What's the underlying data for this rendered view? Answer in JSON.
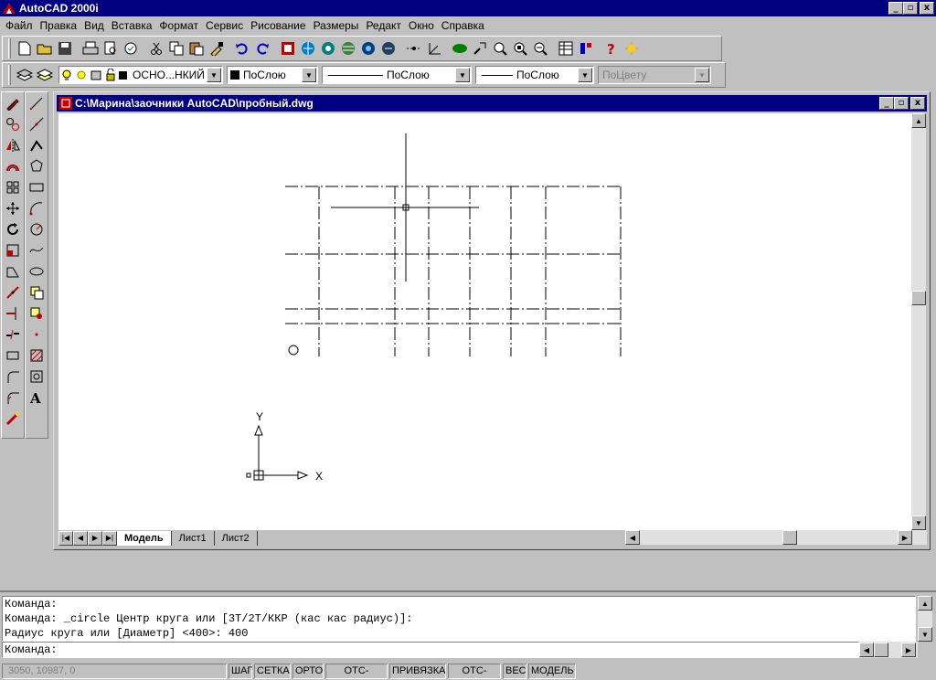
{
  "app": {
    "title": "AutoCAD 2000i",
    "window_buttons": [
      "_",
      "▫",
      "x"
    ]
  },
  "menu": [
    "Файл",
    "Правка",
    "Вид",
    "Вставка",
    "Формат",
    "Сервис",
    "Рисование",
    "Размеры",
    "Редакт",
    "Окно",
    "Справка"
  ],
  "toolbar_standard": {
    "icons": [
      "new-icon",
      "open-icon",
      "save-icon",
      "print-icon",
      "print-preview-icon",
      "spellcheck-icon",
      "cut-icon",
      "copy-icon",
      "paste-icon",
      "match-properties-icon",
      "undo-icon",
      "redo-icon",
      "cad-center-icon",
      "globe-icon",
      "hyperlink-icon",
      "web-icon",
      "browser-icon",
      "browse-icon",
      "snap-icon",
      "ucs-icon",
      "pan-realtime-icon",
      "zoom-realtime-icon",
      "zoom-window-icon",
      "zoom-previous-icon",
      "zoom-extents-icon",
      "properties-icon",
      "design-center-icon",
      "help-icon",
      "today-icon"
    ]
  },
  "layers_bar": {
    "layer_name": "ОСНО...НКИЙ",
    "color": "ПоСлою",
    "linetype": "ПоСлою",
    "lineweight": "ПоСлою",
    "plotstyle": "ПоЦвету"
  },
  "document": {
    "title": "C:\\Марина\\заочники AutoCAD\\пробный.dwg",
    "tabs": [
      "Модель",
      "Лист1",
      "Лист2"
    ],
    "active_tab": "Модель"
  },
  "ucs": {
    "y_label": "Y",
    "x_label": "X"
  },
  "command": {
    "history": [
      "Команда:",
      "Команда: _circle Центр круга или [3T/2T/ККР (кас кас радиус)]:",
      "Радиус круга или [Диаметр] <400>: 400"
    ],
    "prompt": "Команда:"
  },
  "status": {
    "coords": "3050, 10987, 0",
    "buttons": [
      "ШАГ",
      "СЕТКА",
      "ОРТО",
      "ОТС-ПОЛЯР",
      "ПРИВЯЗКА",
      "ОТС-ПРИВ",
      "ВЕС",
      "МОДЕЛЬ"
    ]
  },
  "colors": {
    "title_bar": "#000080",
    "chrome": "#c0c0c0",
    "canvas": "#ffffff"
  }
}
